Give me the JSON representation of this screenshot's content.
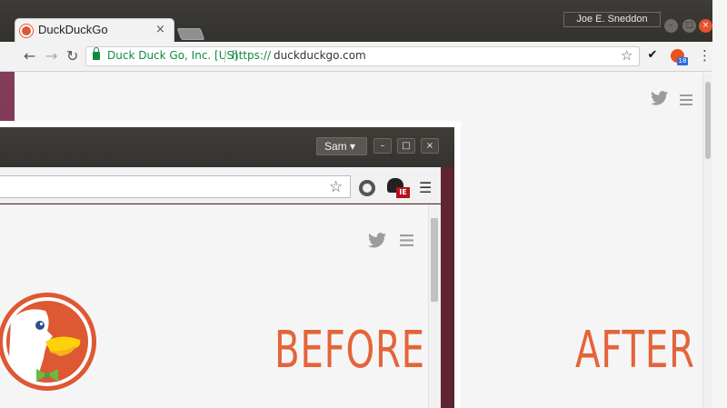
{
  "after": {
    "tab_title": "DuckDuckGo",
    "tab_close": "×",
    "user_name": "Joe E. Sneddon",
    "window_buttons": {
      "minimize": "–",
      "maximize": "□",
      "close": "×"
    },
    "nav": {
      "back": "←",
      "forward": "→",
      "reload": "↻"
    },
    "ev_label": "Duck Duck Go, Inc. [US]",
    "url_scheme": "https://",
    "url_host": "duckduckgo.com",
    "star": "☆",
    "ext_badge": "18",
    "menu": "⋮"
  },
  "before": {
    "user_name": "Sam",
    "window_buttons": {
      "minimize": "–",
      "maximize": "□",
      "close": "×"
    },
    "star": "☆",
    "ext_badge": "IE",
    "menu": "☰"
  },
  "labels": {
    "before": "BEFORE",
    "after": "AFTER"
  },
  "colors": {
    "accent": "#e4643a",
    "ev_green": "#128a3e",
    "ddg_orange": "#de5833"
  },
  "icons": {
    "after_twitter": "twitter-icon",
    "after_hamburger": "hamburger-menu-icon",
    "before_twitter": "twitter-icon",
    "before_hamburger": "hamburger-menu-icon",
    "ddg_logo": "duckduckgo-logo"
  }
}
